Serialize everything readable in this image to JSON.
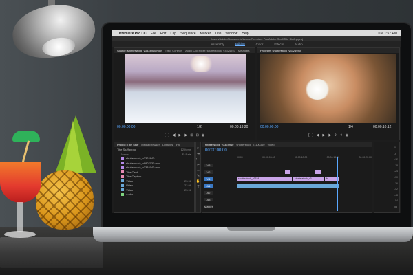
{
  "menubar": {
    "app": "Premiere Pro CC",
    "items": [
      "File",
      "Edit",
      "Clip",
      "Sequence",
      "Marker",
      "Title",
      "Window",
      "Help"
    ],
    "clock": "Tue 1:57 PM"
  },
  "path": "/Users/Adobe/Documents/Adobe/Premiere Pro/Adobe Stuff/Title Stuff.prproj",
  "workspaces": [
    "Assembly",
    "Editing",
    "Color",
    "Effects",
    "Audio"
  ],
  "active_workspace": "Editing",
  "source": {
    "tabs": [
      "Source: shutterstock_v3334940.mov",
      "Effect Controls",
      "Audio Clip Mixer: shutterstock_v3324940",
      "Metadata"
    ],
    "timecode": "00:00:00:00",
    "fit": "1/2",
    "duration": "00:00:13:20"
  },
  "program": {
    "tabs": [
      "Program: shutterstock_v3324940"
    ],
    "timecode": "00:00:00:00",
    "fit": "1/4",
    "duration": "00:00:10:12"
  },
  "project": {
    "tabs": [
      "Project: Title Stuff",
      "Media Browser",
      "Libraries",
      "Info"
    ],
    "name": "Title Stuff.prproj",
    "count": "12 Items",
    "column_name": "Name",
    "column_rate": "Fr Rate",
    "items": [
      {
        "name": "shutterstock_v3324940",
        "len": ""
      },
      {
        "name": "shutterstock_v9807030.mov",
        "len": ""
      },
      {
        "name": "shutterstock_v3334040.mov",
        "len": ""
      },
      {
        "name": "Title Card",
        "len": ""
      },
      {
        "name": "Title Caption",
        "len": ""
      },
      {
        "name": "Video",
        "len": "23.98"
      },
      {
        "name": "Video",
        "len": "23.98"
      },
      {
        "name": "Video",
        "len": "23.98"
      },
      {
        "name": "Audio",
        "len": ""
      }
    ]
  },
  "timeline": {
    "tabs": [
      "shutterstock_v3324940",
      "shutterstock_v1100360",
      "Video"
    ],
    "timecode": "00:00:00:00",
    "ruler": [
      "00:00",
      "00:00:05:00",
      "00:00:10:00",
      "00:00:15:00",
      "00:00:20:00"
    ],
    "tracks": [
      "V3",
      "V2",
      "V1",
      "A1",
      "A2",
      "A3",
      "Master"
    ],
    "clip_a": "shutterstock_v3324",
    "clip_b": "shutterstock_v3",
    "clip_c": "fx"
  },
  "meters": [
    "0",
    "-6",
    "-12",
    "-18",
    "-24",
    "-30",
    "-36",
    "-42",
    "-48",
    "-54",
    "dB"
  ]
}
